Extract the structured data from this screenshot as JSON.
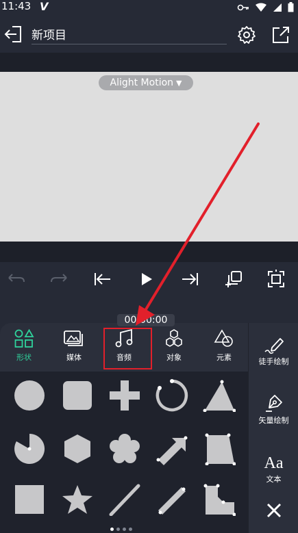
{
  "status": {
    "time": "11:43",
    "v_mark": "V"
  },
  "header": {
    "title": "新项目"
  },
  "watermark": {
    "text": "Alight Motion",
    "caret": "▼"
  },
  "timeline": {
    "timecode": "00:00:00"
  },
  "tabs": [
    {
      "label": "形状",
      "icon": "shapes-icon",
      "active": true
    },
    {
      "label": "媒体",
      "icon": "media-icon",
      "active": false
    },
    {
      "label": "音频",
      "icon": "music-note-icon",
      "active": false
    },
    {
      "label": "对象",
      "icon": "hexagons-icon",
      "active": false
    },
    {
      "label": "元素",
      "icon": "element-shapes-icon",
      "active": false
    }
  ],
  "side": {
    "freehand_label": "徒手绘制",
    "vector_label": "矢量绘制",
    "text_label": "文本",
    "text_icon_glyph": "Aa"
  },
  "shapes": [
    "circle",
    "rounded-square",
    "plus",
    "arc",
    "triangle",
    "pie",
    "hexagon",
    "flower",
    "arrow",
    "trapezoid",
    "square",
    "star",
    "line",
    "thick-line",
    "notched-rect"
  ],
  "colors": {
    "accent": "#2fd39c",
    "highlight": "#e2202b",
    "shape": "#c7c7c9"
  },
  "pager": {
    "count": 4,
    "active": 0
  }
}
